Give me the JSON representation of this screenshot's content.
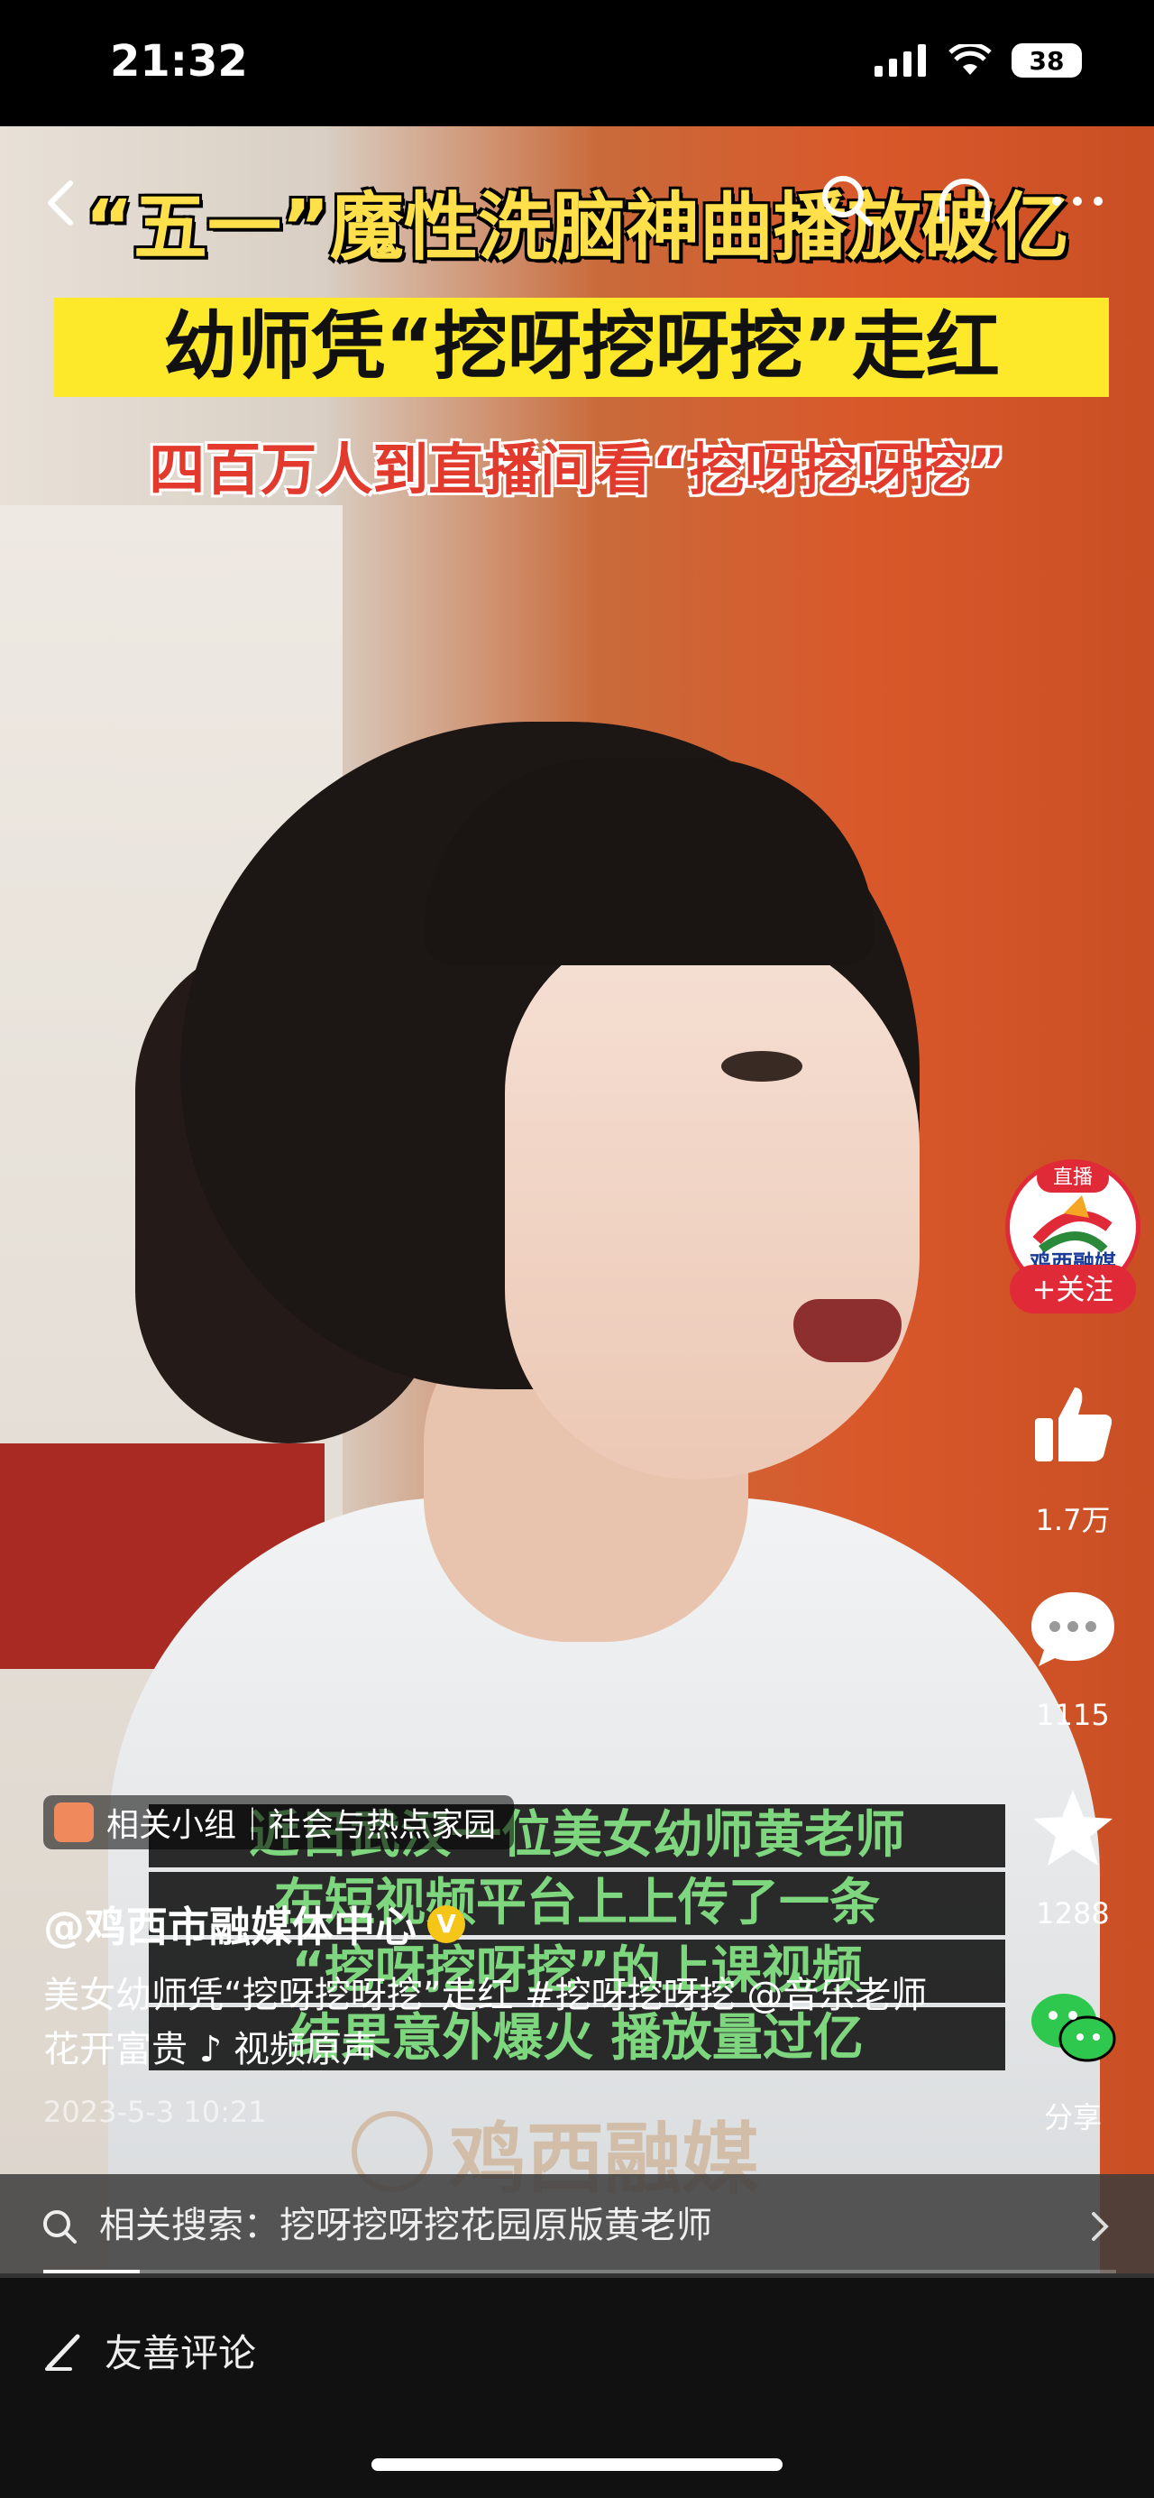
{
  "status_bar": {
    "time": "21:32",
    "battery": "38"
  },
  "video": {
    "headline_line1": "“五一”魔性洗脑神曲播放破亿",
    "headline_line2": "幼师凭“挖呀挖呀挖”走红",
    "headline_line3": "四百万人到直播间看“挖呀挖呀挖”",
    "subtitle_lines": [
      "近日武汉一位美女幼师黄老师",
      "在短视频平台上上传了一条",
      "“挖呀挖呀挖”的上课视频",
      "结果意外爆火 播放量过亿"
    ],
    "watermark": "鸡西融媒"
  },
  "author_avatar": {
    "live_tag": "直播",
    "label": "鸡西融媒",
    "follow_label": "+关注"
  },
  "actions": {
    "likes": "1.7万",
    "comments": "1115",
    "favorites": "1288",
    "share_label": "分享"
  },
  "post": {
    "group_tag": "相关小组｜社会与热点家园",
    "author": "@鸡西市融媒体中心",
    "description": "美女幼师凭“挖呀挖呀挖”走红 #挖呀挖呀挖 @音乐老师花开富贵 ♪ 视频原声",
    "date": "2023-5-3 10:21"
  },
  "related_search": {
    "label": "相关搜索：挖呀挖呀挖花园原版黄老师"
  },
  "progress": {
    "fraction": 0.09
  },
  "bottom": {
    "comment_placeholder": "友善评论"
  },
  "colors": {
    "accent_red": "#e02a37",
    "headline_yellow": "#ffe04a",
    "subtitle_green": "#7ed67e"
  }
}
